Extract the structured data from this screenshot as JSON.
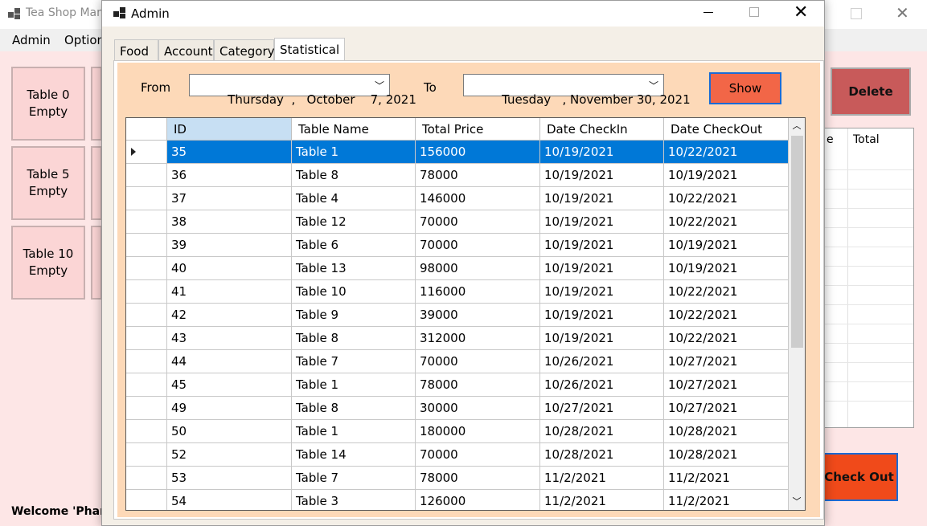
{
  "background_window": {
    "title": "Tea Shop Man",
    "menu": [
      "Admin",
      "Option"
    ],
    "tables": [
      {
        "name": "Table 0",
        "status": "Empty"
      },
      {
        "name": "Table 5",
        "status": "Empty"
      },
      {
        "name": "Table 10",
        "status": "Empty"
      }
    ],
    "delete_label": "Delete",
    "bill_columns": [
      "e",
      "Total"
    ],
    "checkout_label": "Check Out",
    "welcome_text": "Welcome  'Phan"
  },
  "admin": {
    "title": "Admin",
    "tabs": [
      "Food",
      "Account",
      "Category",
      "Statistical"
    ],
    "active_tab": "Statistical",
    "from_label": "From",
    "from_date": "Thursday  ,   October    7, 2021",
    "to_label": "To",
    "to_date": "Tuesday   , November 30, 2021",
    "show_label": "Show",
    "grid": {
      "columns": [
        "ID",
        "Table Name",
        "Total Price",
        "Date CheckIn",
        "Date CheckOut"
      ],
      "rows": [
        [
          "35",
          "Table 1",
          "156000",
          "10/19/2021",
          "10/22/2021"
        ],
        [
          "36",
          "Table 8",
          "78000",
          "10/19/2021",
          "10/19/2021"
        ],
        [
          "37",
          "Table 4",
          "146000",
          "10/19/2021",
          "10/22/2021"
        ],
        [
          "38",
          "Table 12",
          "70000",
          "10/19/2021",
          "10/22/2021"
        ],
        [
          "39",
          "Table 6",
          "70000",
          "10/19/2021",
          "10/19/2021"
        ],
        [
          "40",
          "Table 13",
          "98000",
          "10/19/2021",
          "10/19/2021"
        ],
        [
          "41",
          "Table 10",
          "116000",
          "10/19/2021",
          "10/22/2021"
        ],
        [
          "42",
          "Table 9",
          "39000",
          "10/19/2021",
          "10/22/2021"
        ],
        [
          "43",
          "Table 8",
          "312000",
          "10/19/2021",
          "10/22/2021"
        ],
        [
          "44",
          "Table 7",
          "70000",
          "10/26/2021",
          "10/27/2021"
        ],
        [
          "45",
          "Table 1",
          "78000",
          "10/26/2021",
          "10/27/2021"
        ],
        [
          "49",
          "Table 8",
          "30000",
          "10/27/2021",
          "10/27/2021"
        ],
        [
          "50",
          "Table 1",
          "180000",
          "10/28/2021",
          "10/28/2021"
        ],
        [
          "52",
          "Table 14",
          "70000",
          "10/28/2021",
          "10/28/2021"
        ],
        [
          "53",
          "Table 7",
          "78000",
          "11/2/2021",
          "11/2/2021"
        ],
        [
          "54",
          "Table 3",
          "126000",
          "11/2/2021",
          "11/2/2021"
        ]
      ],
      "selected_row": 0
    }
  }
}
